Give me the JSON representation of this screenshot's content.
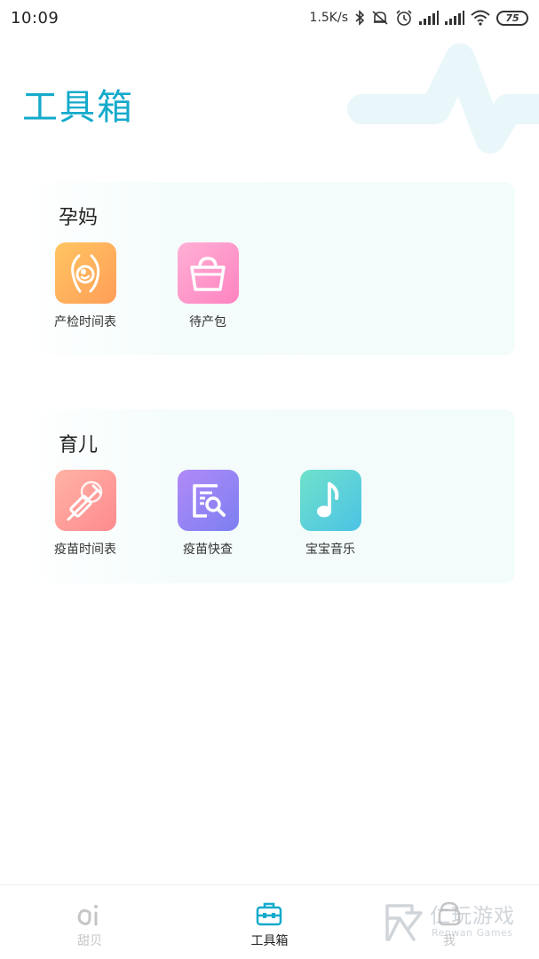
{
  "status_bar": {
    "time": "10:09",
    "net_speed": "1.5K/s",
    "battery": "75",
    "icons": [
      "bluetooth-icon",
      "mute-icon",
      "alarm-icon",
      "signal-icon",
      "signal-icon",
      "wifi-icon",
      "battery-icon"
    ]
  },
  "header": {
    "title": "工具箱",
    "accent_color": "#14aacb"
  },
  "sections": {
    "maternity": {
      "title": "孕妈",
      "items": [
        {
          "label": "产检时间表",
          "icon": "pregnancy-icon"
        },
        {
          "label": "待产包",
          "icon": "bag-icon"
        }
      ]
    },
    "parenting": {
      "title": "育儿",
      "items": [
        {
          "label": "疫苗时间表",
          "icon": "syringe-icon"
        },
        {
          "label": "疫苗快查",
          "icon": "search-document-icon"
        },
        {
          "label": "宝宝音乐",
          "icon": "music-note-icon"
        }
      ]
    }
  },
  "bottom_nav": {
    "items": [
      {
        "label": "甜贝",
        "icon": "tianbei-icon",
        "active": false
      },
      {
        "label": "工具箱",
        "icon": "toolbox-icon",
        "active": true
      },
      {
        "label": "我",
        "icon": "profile-icon",
        "active": false
      }
    ]
  },
  "watermark": {
    "main": "仁玩游戏",
    "sub": "Renwan Games"
  }
}
